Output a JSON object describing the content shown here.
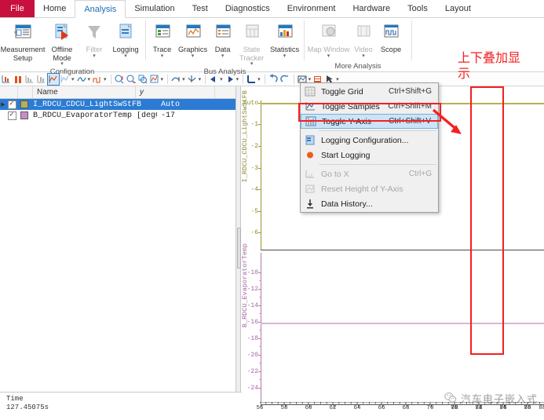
{
  "ribbon": {
    "tabs": [
      {
        "label": "File",
        "kind": "file"
      },
      {
        "label": "Home",
        "active": false
      },
      {
        "label": "Analysis",
        "active": true
      },
      {
        "label": "Simulation",
        "active": false
      },
      {
        "label": "Test",
        "active": false
      },
      {
        "label": "Diagnostics",
        "active": false
      },
      {
        "label": "Environment",
        "active": false
      },
      {
        "label": "Hardware",
        "active": false
      },
      {
        "label": "Tools",
        "active": false
      },
      {
        "label": "Layout",
        "active": false
      }
    ],
    "groups": [
      {
        "label": "Configuration",
        "buttons": [
          {
            "label": "Measurement\nSetup",
            "icon": "measurement-setup-icon",
            "dim": false,
            "caret": false
          },
          {
            "label": "Offline\nMode",
            "icon": "offline-mode-icon",
            "dim": false,
            "caret": true
          },
          {
            "label": "Filter",
            "icon": "filter-icon",
            "dim": true,
            "caret": true
          },
          {
            "label": "Logging",
            "icon": "logging-icon",
            "dim": false,
            "caret": true
          }
        ]
      },
      {
        "label": "Bus Analysis",
        "buttons": [
          {
            "label": "Trace",
            "icon": "trace-icon",
            "dim": false,
            "caret": true
          },
          {
            "label": "Graphics",
            "icon": "graphics-icon",
            "dim": false,
            "caret": true
          },
          {
            "label": "Data",
            "icon": "data-icon",
            "dim": false,
            "caret": true
          },
          {
            "label": "State\nTracker",
            "icon": "state-tracker-icon",
            "dim": true,
            "caret": true
          },
          {
            "label": "Statistics",
            "icon": "statistics-icon",
            "dim": false,
            "caret": true
          }
        ]
      },
      {
        "label": "More Analysis",
        "buttons": [
          {
            "label": "Map Window",
            "icon": "map-window-icon",
            "dim": true,
            "caret": true
          },
          {
            "label": "Video",
            "icon": "video-icon",
            "dim": true,
            "caret": true
          },
          {
            "label": "Scope",
            "icon": "scope-icon",
            "dim": false,
            "caret": false
          }
        ]
      }
    ]
  },
  "toolbar": {
    "items": [
      {
        "name": "measure-cursor-icon",
        "caret": false,
        "selected": false
      },
      {
        "name": "pause-icon",
        "caret": false,
        "selected": false
      },
      {
        "name": "marker-left-icon",
        "caret": false,
        "selected": false
      },
      {
        "name": "marker-right-icon",
        "caret": false,
        "selected": false
      },
      {
        "name": "fit-curve-icon",
        "caret": false,
        "selected": true
      },
      {
        "name": "smooth-curve-icon",
        "caret": true,
        "selected": false
      },
      {
        "name": "wave-icon",
        "caret": true,
        "selected": false
      },
      {
        "name": "step-icon",
        "caret": true,
        "selected": false
      },
      {
        "divider": true
      },
      {
        "name": "zoom-x-icon",
        "caret": false,
        "selected": false
      },
      {
        "name": "zoom-y-icon",
        "caret": false,
        "selected": false
      },
      {
        "name": "zoom-area-icon",
        "caret": false,
        "selected": false
      },
      {
        "name": "zoom-fit-icon",
        "caret": true,
        "selected": false
      },
      {
        "divider": true
      },
      {
        "name": "curve-up-icon",
        "caret": true,
        "selected": false
      },
      {
        "name": "curve-down-icon",
        "caret": true,
        "selected": false
      },
      {
        "divider": true
      },
      {
        "name": "step-back-icon",
        "caret": true,
        "selected": false
      },
      {
        "name": "step-forward-icon",
        "caret": true,
        "selected": false
      },
      {
        "divider": true
      },
      {
        "name": "axis-origin-icon",
        "caret": true,
        "selected": false
      },
      {
        "divider": true
      },
      {
        "name": "undo-icon",
        "caret": false,
        "selected": false
      },
      {
        "name": "redo-icon",
        "caret": false,
        "selected": false
      },
      {
        "divider": true
      },
      {
        "name": "legend-icon",
        "caret": true,
        "selected": false
      },
      {
        "name": "export-icon",
        "caret": false,
        "selected": false
      },
      {
        "name": "pointer-select-icon",
        "caret": true,
        "selected": false
      }
    ]
  },
  "signal_grid": {
    "headers": {
      "name": "Name",
      "y": "y"
    },
    "rows": [
      {
        "name": "I_RDCU_CDCU_LightSwStFB",
        "y": "Auto",
        "color": "#b5b055",
        "checked": true,
        "selected": true,
        "expandable": true
      },
      {
        "name": "B_RDCU_EvaporatorTemp [degC]",
        "y": "-17",
        "color": "#c88ec8",
        "checked": true,
        "selected": false,
        "expandable": false
      }
    ]
  },
  "context_menu": {
    "items": [
      {
        "label": "Toggle Grid",
        "shortcut": "Ctrl+Shift+G",
        "icon": "grid-icon",
        "disabled": false,
        "highlighted": false
      },
      {
        "label": "Toggle Samples",
        "shortcut": "Ctrl+Shift+M",
        "icon": "samples-icon",
        "disabled": false,
        "highlighted": false
      },
      {
        "label": "Toggle Y-Axis",
        "shortcut": "Ctrl+Shift+V",
        "icon": "y-axis-icon",
        "disabled": false,
        "highlighted": true
      },
      {
        "separator": true
      },
      {
        "label": "Logging Configuration...",
        "shortcut": "",
        "icon": "logging-config-icon",
        "disabled": false,
        "highlighted": false
      },
      {
        "label": "Start Logging",
        "shortcut": "",
        "icon": "record-icon",
        "disabled": false,
        "highlighted": false
      },
      {
        "separator": true
      },
      {
        "label": "Go to X",
        "shortcut": "Ctrl+G",
        "icon": "goto-x-icon",
        "disabled": true,
        "highlighted": false
      },
      {
        "label": "Reset Height of Y-Axis",
        "shortcut": "",
        "icon": "reset-height-icon",
        "disabled": true,
        "highlighted": false
      },
      {
        "label": "Data History...",
        "shortcut": "",
        "icon": "data-history-icon",
        "disabled": false,
        "highlighted": false
      }
    ]
  },
  "chart_data": {
    "type": "line",
    "title": "",
    "xlabel": "",
    "grid": false,
    "legend": "left-axis-titles",
    "x_axis": {
      "ticks": [
        56,
        58,
        60,
        62,
        64,
        66,
        68,
        70,
        72,
        74,
        76,
        78,
        80,
        82,
        84,
        86,
        88
      ],
      "range": [
        55,
        89
      ]
    },
    "panes": [
      {
        "name": "I_RDCU_CDCU_LightSwStFB",
        "axis_color": "#9a9632",
        "series_color": "#b5b055",
        "tick_labels": [
          "Auto",
          "-1",
          "-2",
          "-3",
          "-4",
          "-5",
          "-6"
        ],
        "values": [
          0,
          0,
          0,
          0,
          0,
          0,
          0,
          0,
          0,
          0,
          0,
          0,
          0,
          0,
          0,
          0,
          0
        ],
        "constant_value": 0,
        "ylim": [
          -6.5,
          0.4
        ]
      },
      {
        "name": "B_RDCU_EvaporatorTemp",
        "axis_color": "#b07ab0",
        "series_color": "#d8b5d8",
        "tick_labels": [
          "-10",
          "-12",
          "-14",
          "-16",
          "-18",
          "-20",
          "-22",
          "-24"
        ],
        "values": [
          -17,
          -17,
          -17,
          -17,
          -17,
          -17,
          -17,
          -17,
          -17,
          -17,
          -17,
          -17,
          -17,
          -17,
          -17,
          -17,
          -17
        ],
        "constant_value": -17,
        "ylim": [
          -25.5,
          -8.5
        ]
      }
    ]
  },
  "annotations": {
    "note_text": "上下叠加显\n示",
    "note_color": "#f42020"
  },
  "watermark": {
    "text": "汽车电子嵌入式",
    "icon": "wechat-icon"
  },
  "status": {
    "label": "Time",
    "value": "127.45075s"
  }
}
